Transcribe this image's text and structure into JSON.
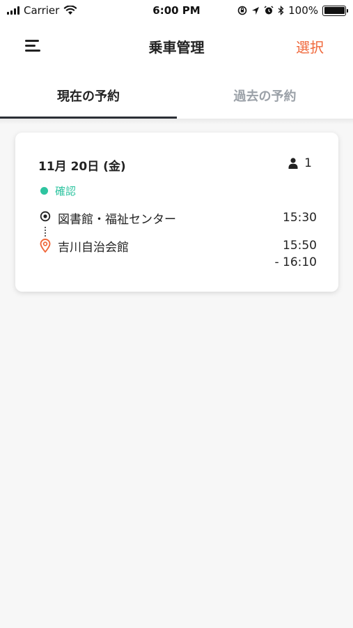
{
  "status_bar": {
    "carrier": "Carrier",
    "time": "6:00 PM",
    "battery": "100%"
  },
  "nav": {
    "title": "乗車管理",
    "select_label": "選択"
  },
  "tabs": [
    {
      "label": "現在の予約",
      "active": true
    },
    {
      "label": "過去の予約",
      "active": false
    }
  ],
  "reservation": {
    "date": "11月 20日 (金)",
    "passengers": "1",
    "status": "確認",
    "status_color": "#2ec4a0",
    "origin": {
      "name": "図書館・福祉センター",
      "time": "15:30"
    },
    "destination": {
      "name": "吉川自治会館",
      "time": "15:50",
      "time_end": "- 16:10"
    }
  },
  "colors": {
    "accent": "#f0673a",
    "status": "#2ec4a0"
  }
}
